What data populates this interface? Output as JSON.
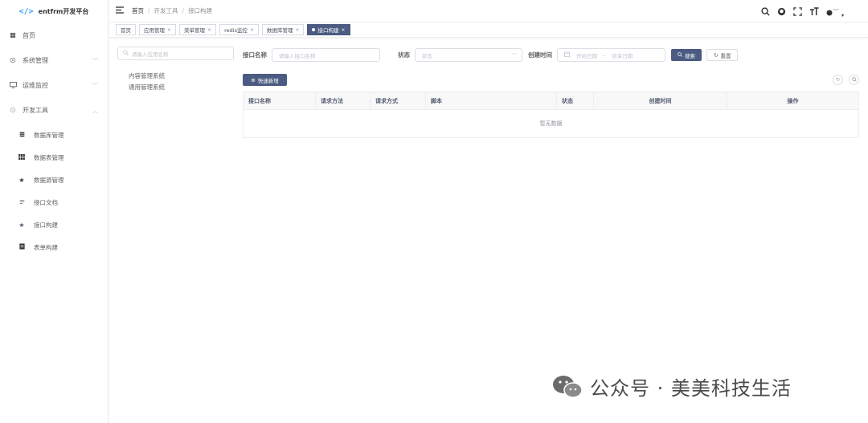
{
  "app": {
    "logo_glyph": "</>",
    "title": "entfrm开发平台"
  },
  "sidebar": {
    "items": [
      {
        "label": "首页",
        "icon": "dashboard-icon"
      },
      {
        "label": "系统管理",
        "icon": "settings-icon"
      },
      {
        "label": "运维监控",
        "icon": "monitor-icon"
      },
      {
        "label": "开发工具",
        "icon": "tools-icon"
      }
    ],
    "sub_items": [
      {
        "label": "数据库管理",
        "icon": "database-icon"
      },
      {
        "label": "数据表管理",
        "icon": "grid-icon"
      },
      {
        "label": "数据源管理",
        "icon": "star-icon"
      },
      {
        "label": "接口文档",
        "icon": "doc-icon"
      },
      {
        "label": "接口构建",
        "icon": "star-icon"
      },
      {
        "label": "表单构建",
        "icon": "form-icon"
      }
    ]
  },
  "breadcrumb": [
    "首页",
    "开发工具",
    "接口构建"
  ],
  "tags": [
    {
      "label": "首页",
      "closable": false
    },
    {
      "label": "应用管理",
      "closable": true
    },
    {
      "label": "菜单管理",
      "closable": true
    },
    {
      "label": "redis监控",
      "closable": true
    },
    {
      "label": "数据库管理",
      "closable": true
    },
    {
      "label": "接口构建",
      "closable": true,
      "active": true
    }
  ],
  "tree": {
    "search_placeholder": "请输入应用名称",
    "nodes": [
      "内容管理系统",
      "通用管理系统"
    ]
  },
  "filters": {
    "api_name_label": "接口名称",
    "api_name_placeholder": "请输入接口名称",
    "status_label": "状态",
    "status_placeholder": "状态",
    "created_label": "创建时间",
    "start_placeholder": "开始日期",
    "range_sep": "-",
    "end_placeholder": "结束日期",
    "search_btn": "搜索",
    "reset_btn": "重置"
  },
  "toolbar": {
    "add_btn": "快速新增"
  },
  "table": {
    "columns": [
      "接口名称",
      "请求方法",
      "请求方式",
      "脚本",
      "状态",
      "创建时间",
      "操作"
    ],
    "empty_text": "暂无数据"
  },
  "watermark": {
    "text": "公众号 · 美美科技生活"
  },
  "colors": {
    "primary": "#4b5b81",
    "accent": "#409eff"
  }
}
